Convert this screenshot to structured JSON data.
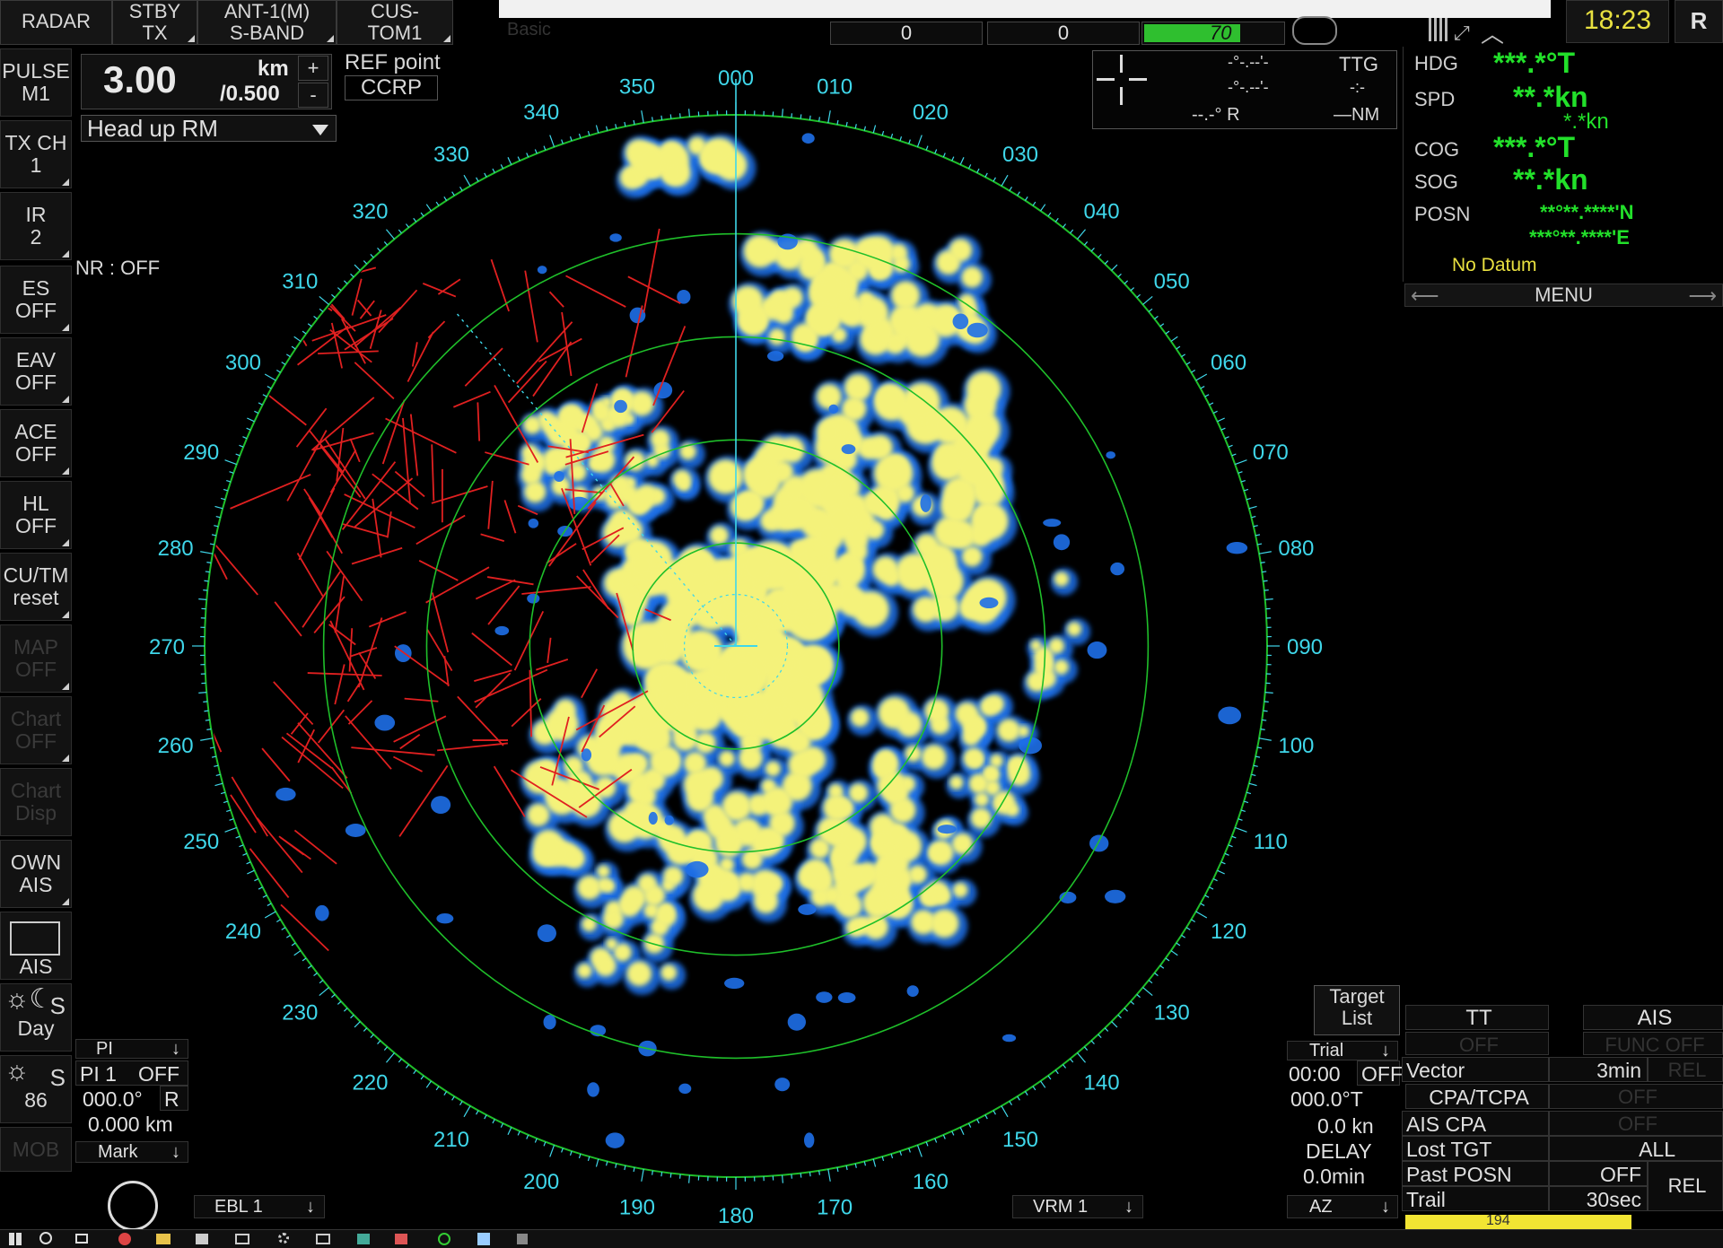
{
  "topbar": {
    "radar": "RADAR",
    "stby_l1": "STBY",
    "stby_l2": "TX",
    "ant_l1": "ANT-1(M)",
    "ant_l2": "S-BAND",
    "cus_l1": "CUS-",
    "cus_l2": "TOM1",
    "basic": "Basic",
    "field1": "0",
    "field2": "0",
    "field3": "70",
    "clock": "18:23",
    "r_btn": "R"
  },
  "range": {
    "value": "3.00",
    "unit": "km",
    "rings": "/0.500",
    "plus": "+",
    "minus": "-",
    "mode": "Head up RM",
    "ref_label": "REF point",
    "ref_value": "CCRP",
    "nr": "NR : OFF"
  },
  "cursor": {
    "bearing1": "-°-.--'-",
    "bearing2": "-°-.--'-",
    "ttg_label": "TTG",
    "ttg_value": "-:-",
    "range_r": "--.-° R",
    "range_nm": "—NM"
  },
  "left_menu": [
    {
      "l1": "PULSE",
      "l2": "M1"
    },
    {
      "l1": "TX CH",
      "l2": "1"
    },
    {
      "l1": "IR",
      "l2": "2"
    },
    {
      "l1": "ES",
      "l2": "OFF"
    },
    {
      "l1": "EAV",
      "l2": "OFF"
    },
    {
      "l1": "ACE",
      "l2": "OFF"
    },
    {
      "l1": "HL",
      "l2": "OFF"
    },
    {
      "l1": "CU/TM",
      "l2": "reset"
    },
    {
      "l1": "MAP",
      "l2": "OFF"
    },
    {
      "l1": "Chart",
      "l2": "OFF"
    },
    {
      "l1": "Chart",
      "l2": "Disp"
    },
    {
      "l1": "OWN",
      "l2": "AIS"
    },
    {
      "l1": "",
      "l2": "AIS"
    },
    {
      "l1": "S",
      "l2": "Day"
    },
    {
      "l1": "S",
      "l2": "86"
    },
    {
      "l1": "MOB",
      "l2": ""
    }
  ],
  "nav": {
    "hdg_label": "HDG",
    "hdg_value": "***.*°T",
    "spd_label": "SPD",
    "spd_value": "**.*kn",
    "spd_sub": "*.*kn",
    "cog_label": "COG",
    "cog_value": "***.*°T",
    "sog_label": "SOG",
    "sog_value": "**.*kn",
    "posn_label": "POSN",
    "posn_lat": "**°**.****'N",
    "posn_lon": "***°**.****'E",
    "datum": "No Datum",
    "menu": "MENU"
  },
  "pi": {
    "header": "PI",
    "pi1": "PI 1",
    "off": "OFF",
    "bearing": "000.0°",
    "r": "R",
    "range": "0.000 km",
    "mark": "Mark"
  },
  "ebl": "EBL 1",
  "vrm": "VRM 1",
  "trial": {
    "header": "Trial",
    "time": "00:00",
    "off": "OFF",
    "course": "000.0°T",
    "speed": "0.0 kn",
    "delay_label": "DELAY",
    "delay_value": "0.0min",
    "az": "AZ"
  },
  "target_list": "Target\nList",
  "target_list_l1": "Target",
  "target_list_l2": "List",
  "tt_panel": {
    "tt": "TT",
    "ais": "AIS",
    "tt_off": "OFF",
    "ais_func": "FUNC OFF",
    "vector_label": "Vector",
    "vector_value": "3min",
    "vector_mode": "REL",
    "cpa_label": "CPA/TCPA",
    "cpa_value": "OFF",
    "aiscpa_label": "AIS CPA",
    "aiscpa_value": "OFF",
    "lost_label": "Lost TGT",
    "lost_value": "ALL",
    "past_label": "Past POSN",
    "past_value": "OFF",
    "trail_label": "Trail",
    "trail_value": "30sec",
    "rel": "REL",
    "bottom_val": "194"
  },
  "bearing_labels": [
    "000",
    "010",
    "020",
    "030",
    "040",
    "050",
    "060",
    "070",
    "080",
    "090",
    "100",
    "110",
    "120",
    "130",
    "140",
    "150",
    "160",
    "170",
    "180",
    "190",
    "200",
    "210",
    "220",
    "230",
    "240",
    "250",
    "260",
    "270",
    "280",
    "290",
    "300",
    "310",
    "320",
    "330",
    "340",
    "350"
  ],
  "colors": {
    "echo_yellow": "#f4f27a",
    "echo_blue": "#1e6fe8",
    "ring_green": "#1fbf2a",
    "scale_cyan": "#3fd7ea",
    "trail_red": "#e02020",
    "nav_green": "#22e02a",
    "datum_yellow": "#e8e040"
  }
}
